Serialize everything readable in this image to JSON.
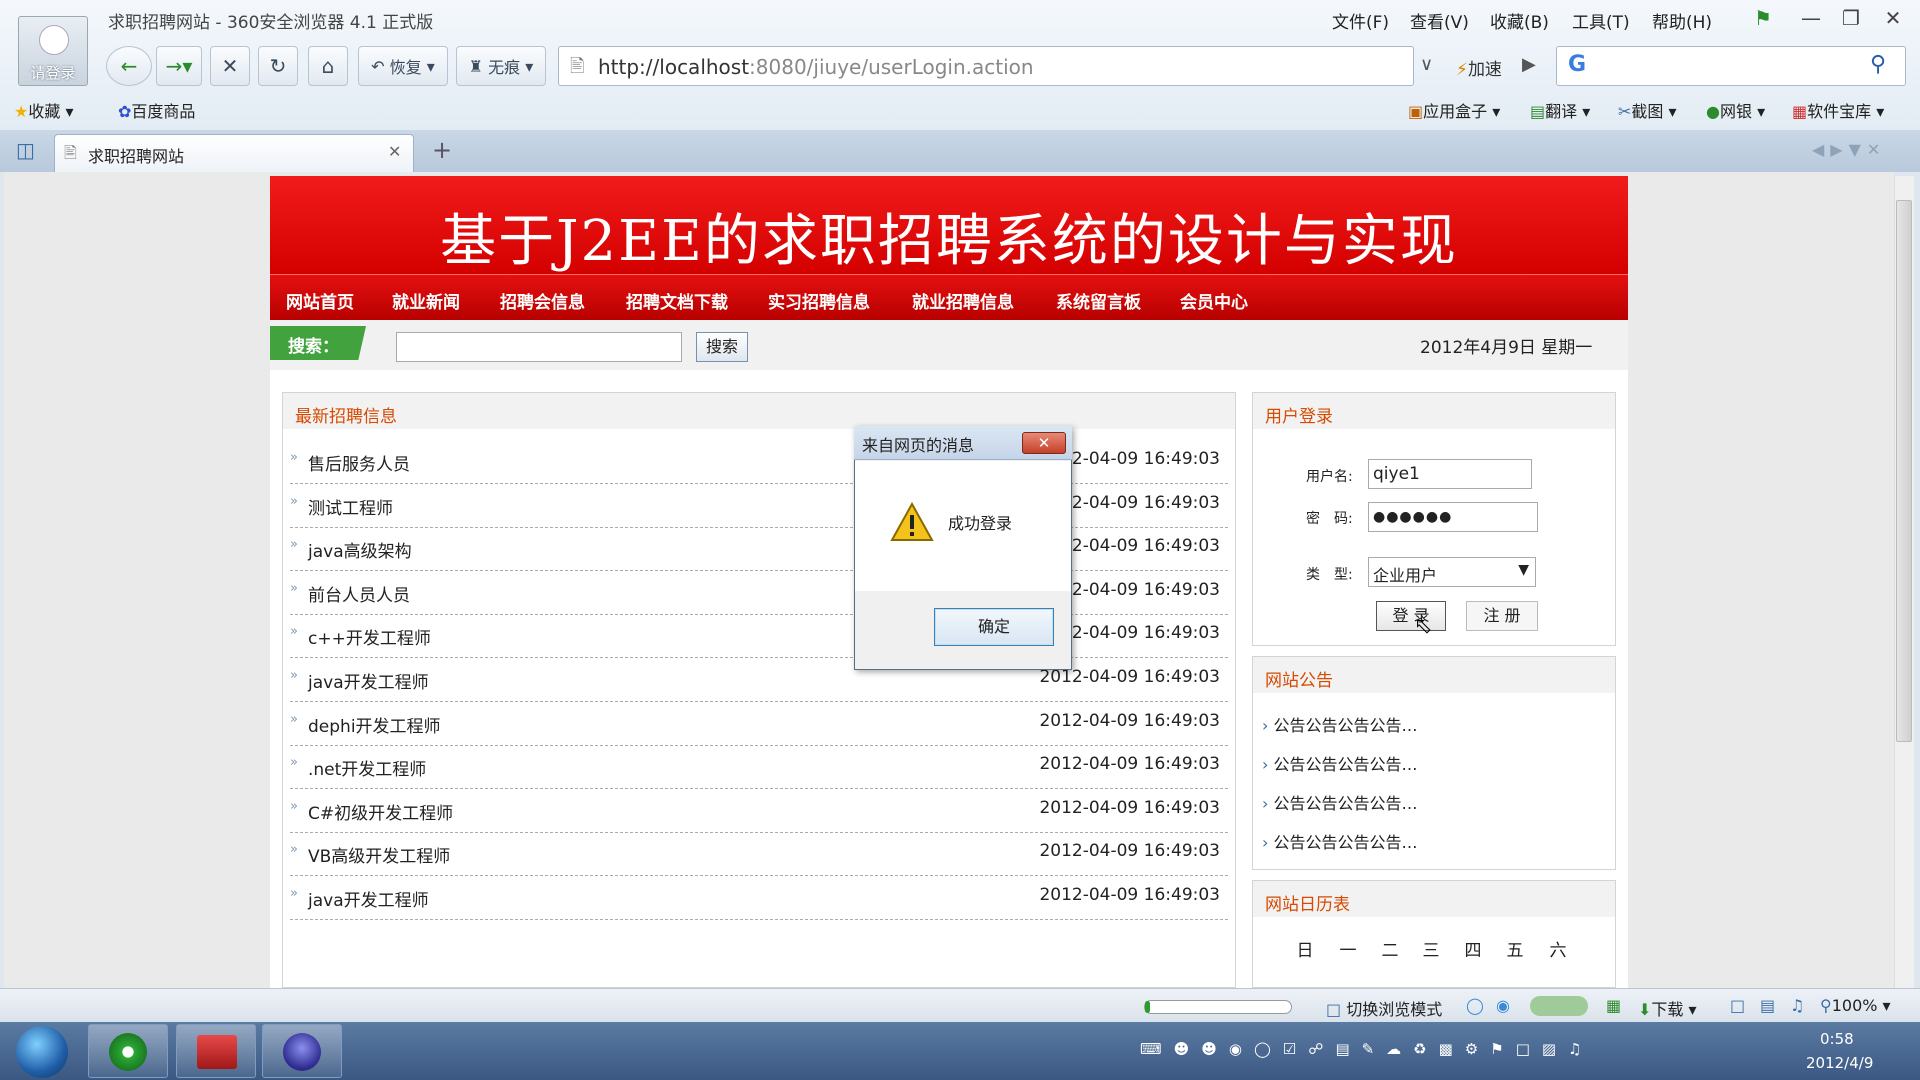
{
  "browser": {
    "window_title": "求职招聘网站 - 360安全浏览器 4.1 正式版",
    "avatar_label": "请登录",
    "menu": [
      "文件(F)",
      "查看(V)",
      "收藏(B)",
      "工具(T)",
      "帮助(H)"
    ],
    "restore_label": "恢复",
    "incognito_label": "无痕",
    "address": {
      "host": "http://localhost",
      "rest": ":8080/jiuye/userLogin.action"
    },
    "speed_label": "加速",
    "favorites": [
      "收藏",
      "百度商品"
    ],
    "toolbar_right": [
      "应用盒子",
      "翻译",
      "截图",
      "网银",
      "软件宝库"
    ],
    "tab_title": "求职招聘网站",
    "status": {
      "switch_mode": "切换浏览模式",
      "download": "下载",
      "zoom": "100%"
    }
  },
  "site": {
    "banner_title": "基于J2EE的求职招聘系统的设计与实现",
    "nav": [
      "网站首页",
      "就业新闻",
      "招聘会信息",
      "招聘文档下载",
      "实习招聘信息",
      "就业招聘信息",
      "系统留言板",
      "会员中心"
    ],
    "search_tag": "搜索：",
    "search_button": "搜索",
    "date": "2012年4月9日 星期一"
  },
  "jobs_panel": {
    "title": "最新招聘信息",
    "items": [
      {
        "name": "售后服务人员",
        "time": "2012-04-09 16:49:03"
      },
      {
        "name": "测试工程师",
        "time": "2012-04-09 16:49:03"
      },
      {
        "name": "java高级架构",
        "time": "2012-04-09 16:49:03"
      },
      {
        "name": "前台人员人员",
        "time": "2012-04-09 16:49:03"
      },
      {
        "name": "c++开发工程师",
        "time": "2012-04-09 16:49:03"
      },
      {
        "name": "java开发工程师",
        "time": "2012-04-09 16:49:03"
      },
      {
        "name": "dephi开发工程师",
        "time": "2012-04-09 16:49:03"
      },
      {
        "name": ".net开发工程师",
        "time": "2012-04-09 16:49:03"
      },
      {
        "name": "C#初级开发工程师",
        "time": "2012-04-09 16:49:03"
      },
      {
        "name": "VB高级开发工程师",
        "time": "2012-04-09 16:49:03"
      },
      {
        "name": "java开发工程师",
        "time": "2012-04-09 16:49:03"
      }
    ]
  },
  "login": {
    "title": "用户登录",
    "username_label": "用户名:",
    "username_value": "qiye1",
    "password_label": "密　码:",
    "password_value": "●●●●●●",
    "type_label": "类　型:",
    "type_value": "企业用户",
    "login_button": "登 录",
    "register_button": "注 册"
  },
  "notice": {
    "title": "网站公告",
    "items": [
      "公告公告公告公告…",
      "公告公告公告公告…",
      "公告公告公告公告…",
      "公告公告公告公告…"
    ]
  },
  "calendar": {
    "title": "网站日历表",
    "weekdays": [
      "日",
      "一",
      "二",
      "三",
      "四",
      "五",
      "六"
    ]
  },
  "dialog": {
    "title": "来自网页的消息",
    "message": "成功登录",
    "ok_button": "确定"
  },
  "taskbar": {
    "time": "0:58",
    "date": "2012/4/9"
  }
}
